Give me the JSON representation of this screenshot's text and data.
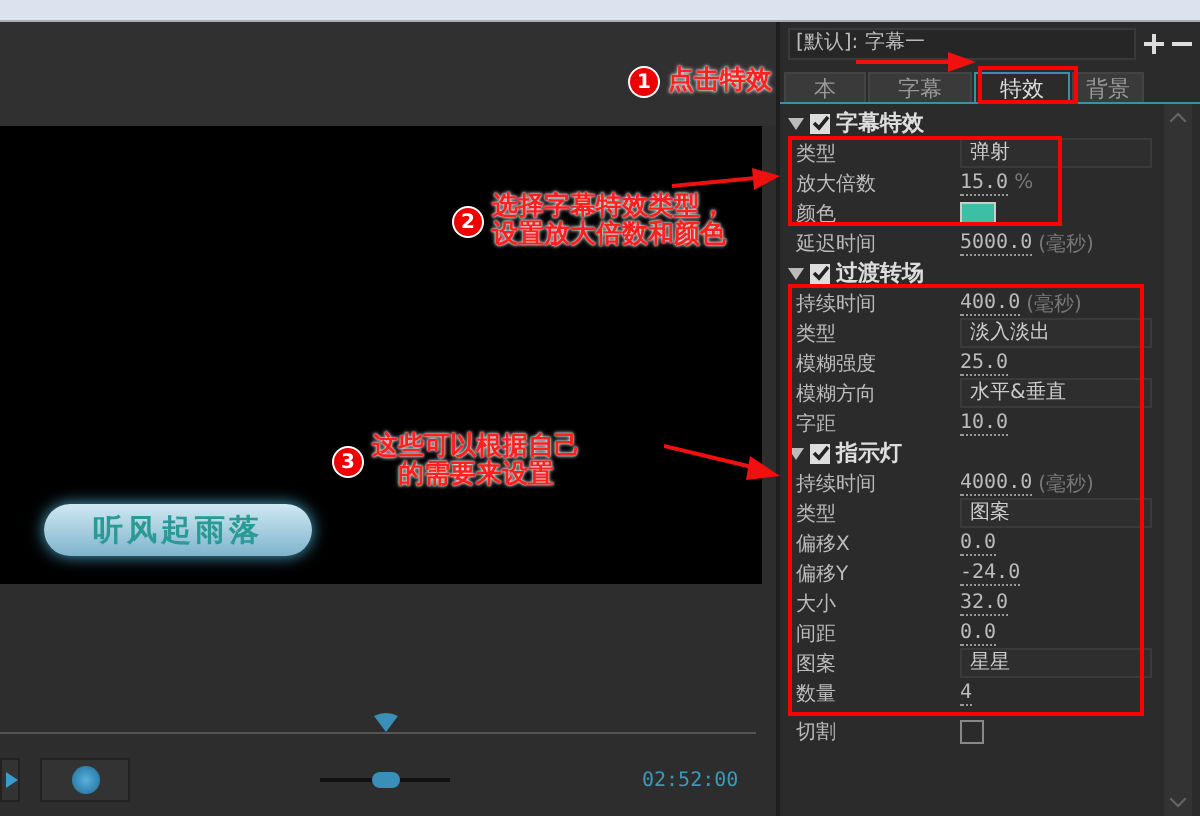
{
  "preview": {
    "subtitle": "听风起雨落"
  },
  "player": {
    "time": "02:52:00",
    "zoom": {
      "level": 0.5
    }
  },
  "panel": {
    "preset": "[默认]: 字幕一",
    "tabs": [
      {
        "label": "本",
        "selected": false
      },
      {
        "label": "字幕",
        "selected": false
      },
      {
        "label": "特效",
        "selected": true
      },
      {
        "label": "背景",
        "selected": false
      }
    ],
    "sections": [
      {
        "title": "字幕特效",
        "checked": true,
        "expanded": true,
        "rows": [
          {
            "kind": "select",
            "label": "类型",
            "value": "弹射"
          },
          {
            "kind": "number",
            "label": "放大倍数",
            "value": "15.0",
            "unit": "%"
          },
          {
            "kind": "color",
            "label": "颜色",
            "color": "#3dbfa6"
          },
          {
            "kind": "number",
            "label": "延迟时间",
            "value": "5000.0",
            "unit": "(毫秒)"
          }
        ]
      },
      {
        "title": "过渡转场",
        "checked": true,
        "expanded": true,
        "rows": [
          {
            "kind": "number",
            "label": "持续时间",
            "value": "400.0",
            "unit": "(毫秒)"
          },
          {
            "kind": "select",
            "label": "类型",
            "value": "淡入淡出"
          },
          {
            "kind": "number",
            "label": "模糊强度",
            "value": "25.0"
          },
          {
            "kind": "select",
            "label": "模糊方向",
            "value": "水平&垂直"
          },
          {
            "kind": "number",
            "label": "字距",
            "value": "10.0"
          }
        ]
      },
      {
        "title": "指示灯",
        "checked": true,
        "expanded": true,
        "rows": [
          {
            "kind": "number",
            "label": "持续时间",
            "value": "4000.0",
            "unit": "(毫秒)"
          },
          {
            "kind": "select",
            "label": "类型",
            "value": "图案"
          },
          {
            "kind": "number",
            "label": "偏移X",
            "value": "0.0"
          },
          {
            "kind": "number",
            "label": "偏移Y",
            "value": "-24.0"
          },
          {
            "kind": "number",
            "label": "大小",
            "value": "32.0"
          },
          {
            "kind": "number",
            "label": "间距",
            "value": "0.0"
          },
          {
            "kind": "select",
            "label": "图案",
            "value": "星星"
          },
          {
            "kind": "number",
            "label": "数量",
            "value": "4"
          },
          {
            "kind": "checkbox",
            "label": "切割",
            "checked": false
          }
        ]
      }
    ]
  },
  "annotations": [
    {
      "number": "1",
      "lines": [
        "点击特效"
      ]
    },
    {
      "number": "2",
      "lines": [
        "选择字幕特效类型，",
        "设置放大倍数和颜色"
      ]
    },
    {
      "number": "3",
      "lines": [
        "这些可以根据自己",
        "的需要来设置"
      ]
    }
  ]
}
